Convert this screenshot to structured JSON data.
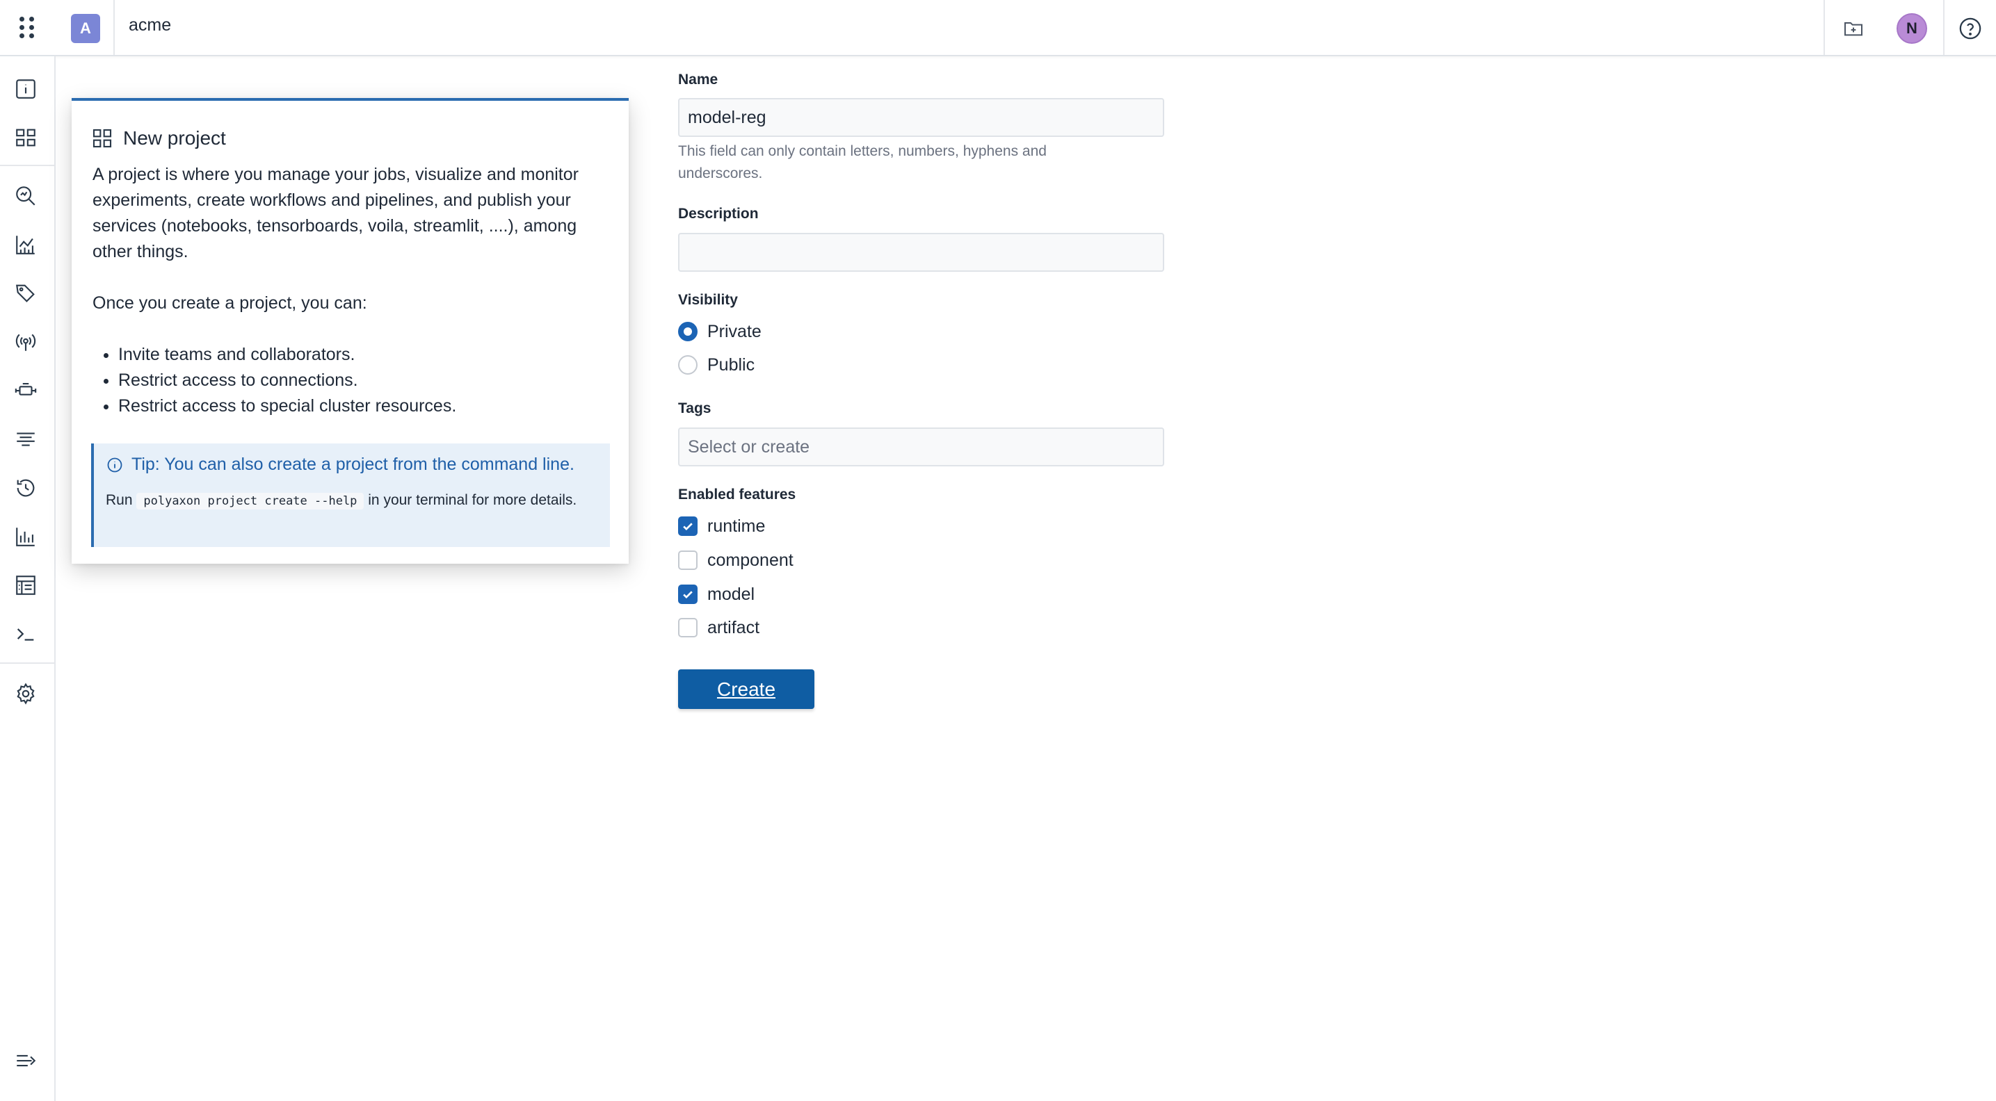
{
  "header": {
    "org_initial": "A",
    "org_name": "acme",
    "user_initial": "N"
  },
  "sidebar": {
    "items": [
      {
        "name": "info-icon"
      },
      {
        "name": "dashboard-grid-icon"
      },
      {
        "name": "search-icon"
      },
      {
        "name": "analytics-chart-icon"
      },
      {
        "name": "tag-icon"
      },
      {
        "name": "broadcast-icon"
      },
      {
        "name": "agent-icon"
      },
      {
        "name": "filter-lines-icon"
      },
      {
        "name": "history-icon"
      },
      {
        "name": "bar-chart-icon"
      },
      {
        "name": "table-list-icon"
      },
      {
        "name": "terminal-icon"
      },
      {
        "name": "settings-gear-icon"
      },
      {
        "name": "expand-sidebar-icon"
      }
    ]
  },
  "info_card": {
    "title": "New project",
    "paragraph1": "A project is where you manage your jobs, visualize and monitor experiments, create workflows and pipelines, and publish your services (notebooks, tensorboards, voila, streamlit, ....), among other things.",
    "paragraph2": "Once you create a project, you can:",
    "bullets": [
      "Invite teams and collaborators.",
      "Restrict access to connections.",
      "Restrict access to special cluster resources."
    ],
    "tip_title": "Tip: You can also create a project from the command line.",
    "tip_run": "Run",
    "tip_code": "polyaxon project create --help",
    "tip_rest": "in your terminal for more details."
  },
  "form": {
    "name_label": "Name",
    "name_value": "model-reg",
    "name_help": "This field can only contain letters, numbers, hyphens and underscores.",
    "description_label": "Description",
    "description_value": "",
    "visibility_label": "Visibility",
    "visibility_options": [
      {
        "label": "Private",
        "selected": true
      },
      {
        "label": "Public",
        "selected": false
      }
    ],
    "tags_label": "Tags",
    "tags_placeholder": "Select or create",
    "features_label": "Enabled features",
    "features": [
      {
        "label": "runtime",
        "checked": true
      },
      {
        "label": "component",
        "checked": false
      },
      {
        "label": "model",
        "checked": true
      },
      {
        "label": "artifact",
        "checked": false
      }
    ],
    "create_label": "Create"
  },
  "colors": {
    "accent": "#1c64b5",
    "button": "#0f5da3",
    "org_badge": "#7b86d6",
    "avatar": "#b98bd6",
    "tip_bg": "#e7f0f9"
  }
}
